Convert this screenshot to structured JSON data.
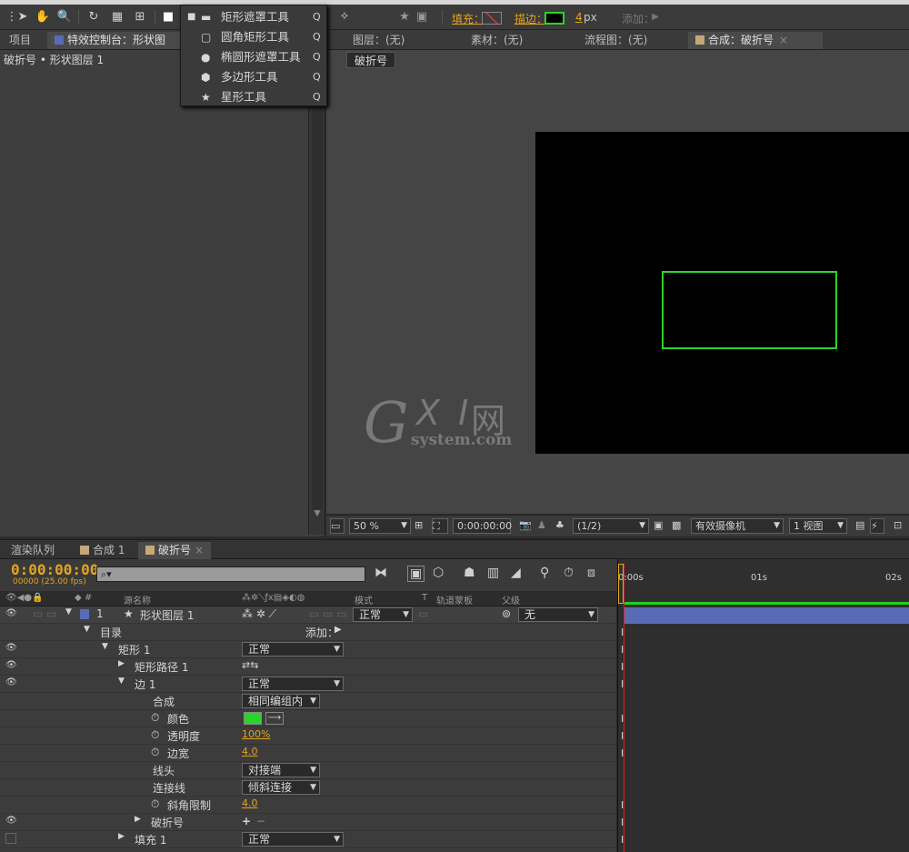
{
  "colors": {
    "accent_orange": "#e5a41c",
    "shape_stroke": "#2ad52a",
    "layer_blue": "#5a6bb5",
    "playhead": "#dd2222"
  },
  "toolbar": {
    "fill_label": "填充：",
    "stroke_label": "描边：",
    "stroke_width_value": "4",
    "stroke_width_unit": "px",
    "add_label": "添加："
  },
  "dropdown": {
    "items": [
      {
        "label": "矩形遮罩工具",
        "key": "Q",
        "icon": "rectangle-icon",
        "selected": true
      },
      {
        "label": "圆角矩形工具",
        "key": "Q",
        "icon": "rounded-rect-icon"
      },
      {
        "label": "椭圆形遮罩工具",
        "key": "Q",
        "icon": "ellipse-icon"
      },
      {
        "label": "多边形工具",
        "key": "Q",
        "icon": "polygon-icon"
      },
      {
        "label": "星形工具",
        "key": "Q",
        "icon": "star-icon"
      }
    ]
  },
  "tabs": {
    "project": "项目",
    "effect_controls": "特效控制台：形状图",
    "layer": "图层：(无)",
    "footage": "素材：(无)",
    "flowchart": "流程图：(无)",
    "composition": "合成：破折号"
  },
  "left_panel": {
    "breadcrumb": "破折号 • 形状图层 1"
  },
  "viewer": {
    "comp_tag": "破折号",
    "zoom": "50 %",
    "timecode": "0:00:00:00",
    "resolution": "(1/2)",
    "camera": "有效摄像机",
    "views": "1 视图"
  },
  "watermark": {
    "g": "G",
    "xi": "X I",
    "cn": "网",
    "system": "system.com"
  },
  "timeline": {
    "tabs": [
      "渲染队列",
      "合成 1",
      "破折号"
    ],
    "timecode": "0:00:00:00",
    "fps": "00000 (25.00 fps)",
    "search_placeholder": "",
    "ruler": [
      "0:00s",
      "01s",
      "02s"
    ],
    "columns": {
      "source_name": "源名称",
      "mode": "模式",
      "t": "T",
      "track_matte": "轨道蒙板",
      "parent": "父级"
    },
    "layer": {
      "index": "1",
      "name": "形状图层 1",
      "mode": "正常",
      "parent": "无"
    },
    "rows": [
      {
        "label": "目录",
        "extra": "添加："
      },
      {
        "label": "矩形 1",
        "value": "正常"
      },
      {
        "label": "矩形路径 1"
      },
      {
        "label": "边 1",
        "value": "正常"
      },
      {
        "label": "合成",
        "value": "相同编组内"
      },
      {
        "label": "颜色"
      },
      {
        "label": "透明度",
        "value": "100%"
      },
      {
        "label": "边宽",
        "value": "4.0"
      },
      {
        "label": "线头",
        "value": "对接端"
      },
      {
        "label": "连接线",
        "value": "倾斜连接"
      },
      {
        "label": "斜角限制",
        "value": "4.0"
      },
      {
        "label": "破折号"
      },
      {
        "label": "填充 1",
        "value": "正常"
      }
    ]
  }
}
